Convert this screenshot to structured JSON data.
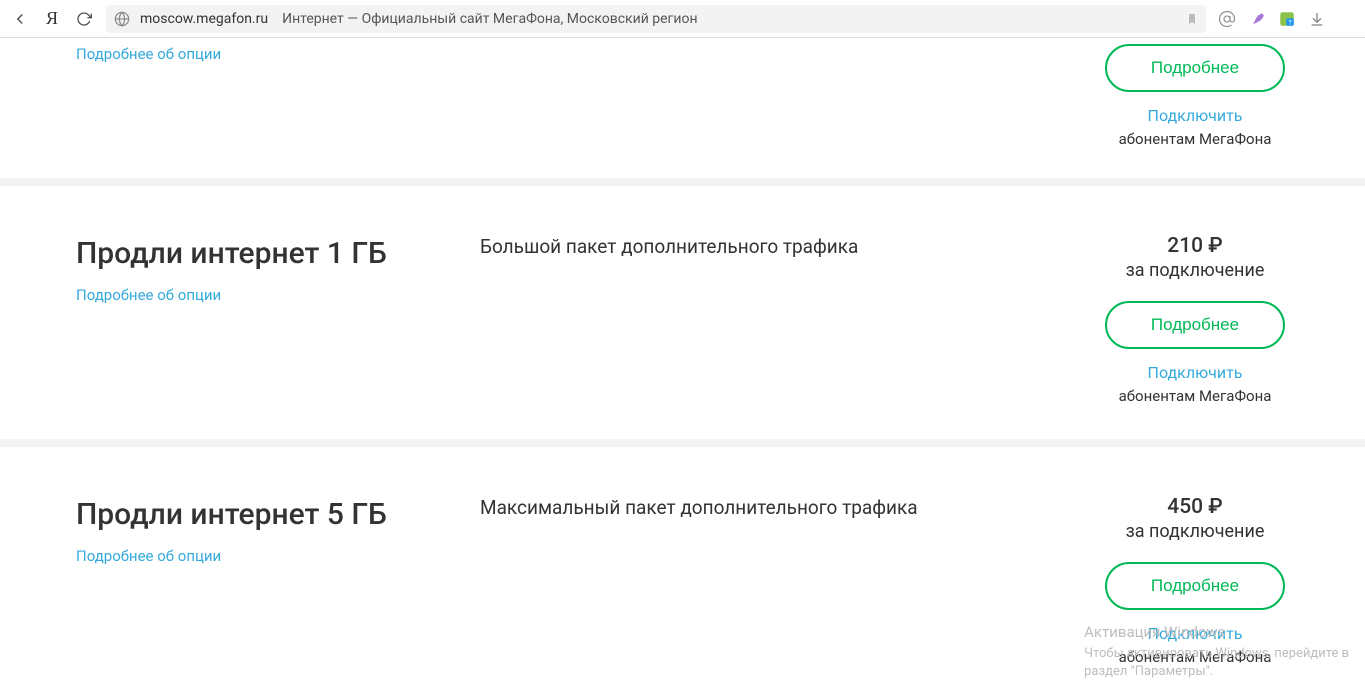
{
  "browser": {
    "url": "moscow.megafon.ru",
    "title": "Интернет — Официальный сайт МегаФона, Московский регион"
  },
  "top_card": {
    "more_link": "Подробнее об опции",
    "btn_more": "Подробнее",
    "connect": "Подключить",
    "connect_sub": "абонентам МегаФона"
  },
  "cards": [
    {
      "title": "Продли интернет 1 ГБ",
      "more_link": "Подробнее об опции",
      "desc": "Большой пакет дополнительного трафика",
      "price": "210 ₽",
      "price_sub": "за подключение",
      "btn_more": "Подробнее",
      "connect": "Подключить",
      "connect_sub": "абонентам МегаФона"
    },
    {
      "title": "Продли интернет 5 ГБ",
      "more_link": "Подробнее об опции",
      "desc": "Максимальный пакет дополнительного трафика",
      "price": "450 ₽",
      "price_sub": "за подключение",
      "btn_more": "Подробнее",
      "connect": "Подключить",
      "connect_sub": "абонентам МегаФона"
    }
  ],
  "watermark": {
    "title": "Активация Windows",
    "line1": "Чтобы активировать Windows, перейдите в",
    "line2": "раздел \"Параметры\"."
  }
}
